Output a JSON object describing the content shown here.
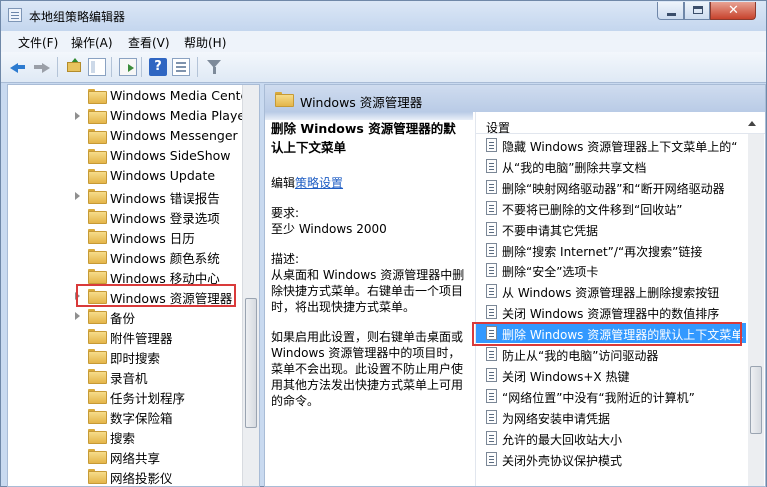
{
  "window": {
    "title": "本地组策略编辑器"
  },
  "menu": [
    "文件(F)",
    "操作(A)",
    "查看(V)",
    "帮助(H)"
  ],
  "tree": [
    {
      "label": "Windows Media Cente",
      "expander": false
    },
    {
      "label": "Windows Media Player",
      "expander": true
    },
    {
      "label": "Windows Messenger",
      "expander": false
    },
    {
      "label": "Windows SideShow",
      "expander": false
    },
    {
      "label": "Windows Update",
      "expander": false
    },
    {
      "label": "Windows 错误报告",
      "expander": true
    },
    {
      "label": "Windows 登录选项",
      "expander": false
    },
    {
      "label": "Windows 日历",
      "expander": false
    },
    {
      "label": "Windows 颜色系统",
      "expander": false
    },
    {
      "label": "Windows 移动中心",
      "expander": false
    },
    {
      "label": "Windows 资源管理器",
      "expander": true,
      "selected": true
    },
    {
      "label": "备份",
      "expander": true
    },
    {
      "label": "附件管理器",
      "expander": false
    },
    {
      "label": "即时搜索",
      "expander": false
    },
    {
      "label": "录音机",
      "expander": false
    },
    {
      "label": "任务计划程序",
      "expander": false
    },
    {
      "label": "数字保险箱",
      "expander": false
    },
    {
      "label": "搜索",
      "expander": false
    },
    {
      "label": "网络共享",
      "expander": false
    },
    {
      "label": "网络投影仪",
      "expander": false
    }
  ],
  "detail": {
    "header": "Windows 资源管理器",
    "policy_title": "删除 Windows 资源管理器的默认上下文菜单",
    "edit_prefix": "编辑",
    "edit_link": "策略设置",
    "req_label": "要求:",
    "req_value": "至少 Windows 2000",
    "desc_label": "描述:",
    "desc_text": "从桌面和 Windows 资源管理器中删除快捷方式菜单。右键单击一个项目时，将出现快捷方式菜单。",
    "desc_extra": "如果启用此设置，则右键单击桌面或 Windows 资源管理器中的项目时，菜单不会出现。此设置不防止用户使用其他方法发出快捷方式菜单上可用的命令。"
  },
  "list": {
    "header": "设置",
    "items": [
      "隐藏 Windows 资源管理器上下文菜单上的“",
      "从“我的电脑”删除共享文档",
      "删除“映射网络驱动器”和“断开网络驱动器",
      "不要将已删除的文件移到“回收站”",
      "不要申请其它凭据",
      "删除“搜索 Internet”/“再次搜索”链接",
      "删除“安全”选项卡",
      "从 Windows 资源管理器上删除搜索按钮",
      "关闭 Windows 资源管理器中的数值排序",
      "删除 Windows 资源管理器的默认上下文菜单",
      "防止从“我的电脑”访问驱动器",
      "关闭 Windows+X 热键",
      "“网络位置”中没有“我附近的计算机”",
      "为网络安装申请凭据",
      "允许的最大回收站大小",
      "关闭外壳协议保护模式"
    ],
    "selected_index": 9
  },
  "colors": {
    "selection": "#3399ff",
    "highlight_box": "#d93a3a",
    "link": "#1f5ec4"
  }
}
